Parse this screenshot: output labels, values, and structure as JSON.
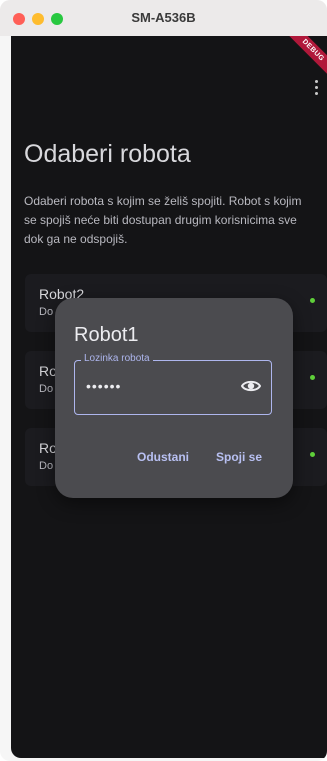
{
  "window": {
    "title": "SM-A536B"
  },
  "debug_banner": "DEBUG",
  "page": {
    "title": "Odaberi robota",
    "description": "Odaberi robota s kojim se želiš spojiti. Robot s kojim se spojiš neće biti dostupan drugim korisnicima sve dok ga ne odspojiš."
  },
  "robots": [
    {
      "name": "Robot2",
      "status": "Do",
      "indicator_color": "#5fcf3a"
    },
    {
      "name": "Ro",
      "status": "Do",
      "indicator_color": "#5fcf3a"
    },
    {
      "name": "Ro",
      "status": "Do",
      "indicator_color": "#5fcf3a"
    }
  ],
  "dialog": {
    "title": "Robot1",
    "password_label": "Lozinka robota",
    "password_value": "••••••",
    "cancel_label": "Odustani",
    "connect_label": "Spoji se"
  },
  "colors": {
    "background": "#141416",
    "dialog": "#4b4b4f",
    "accent": "#aeb6ee",
    "online": "#5fcf3a"
  }
}
